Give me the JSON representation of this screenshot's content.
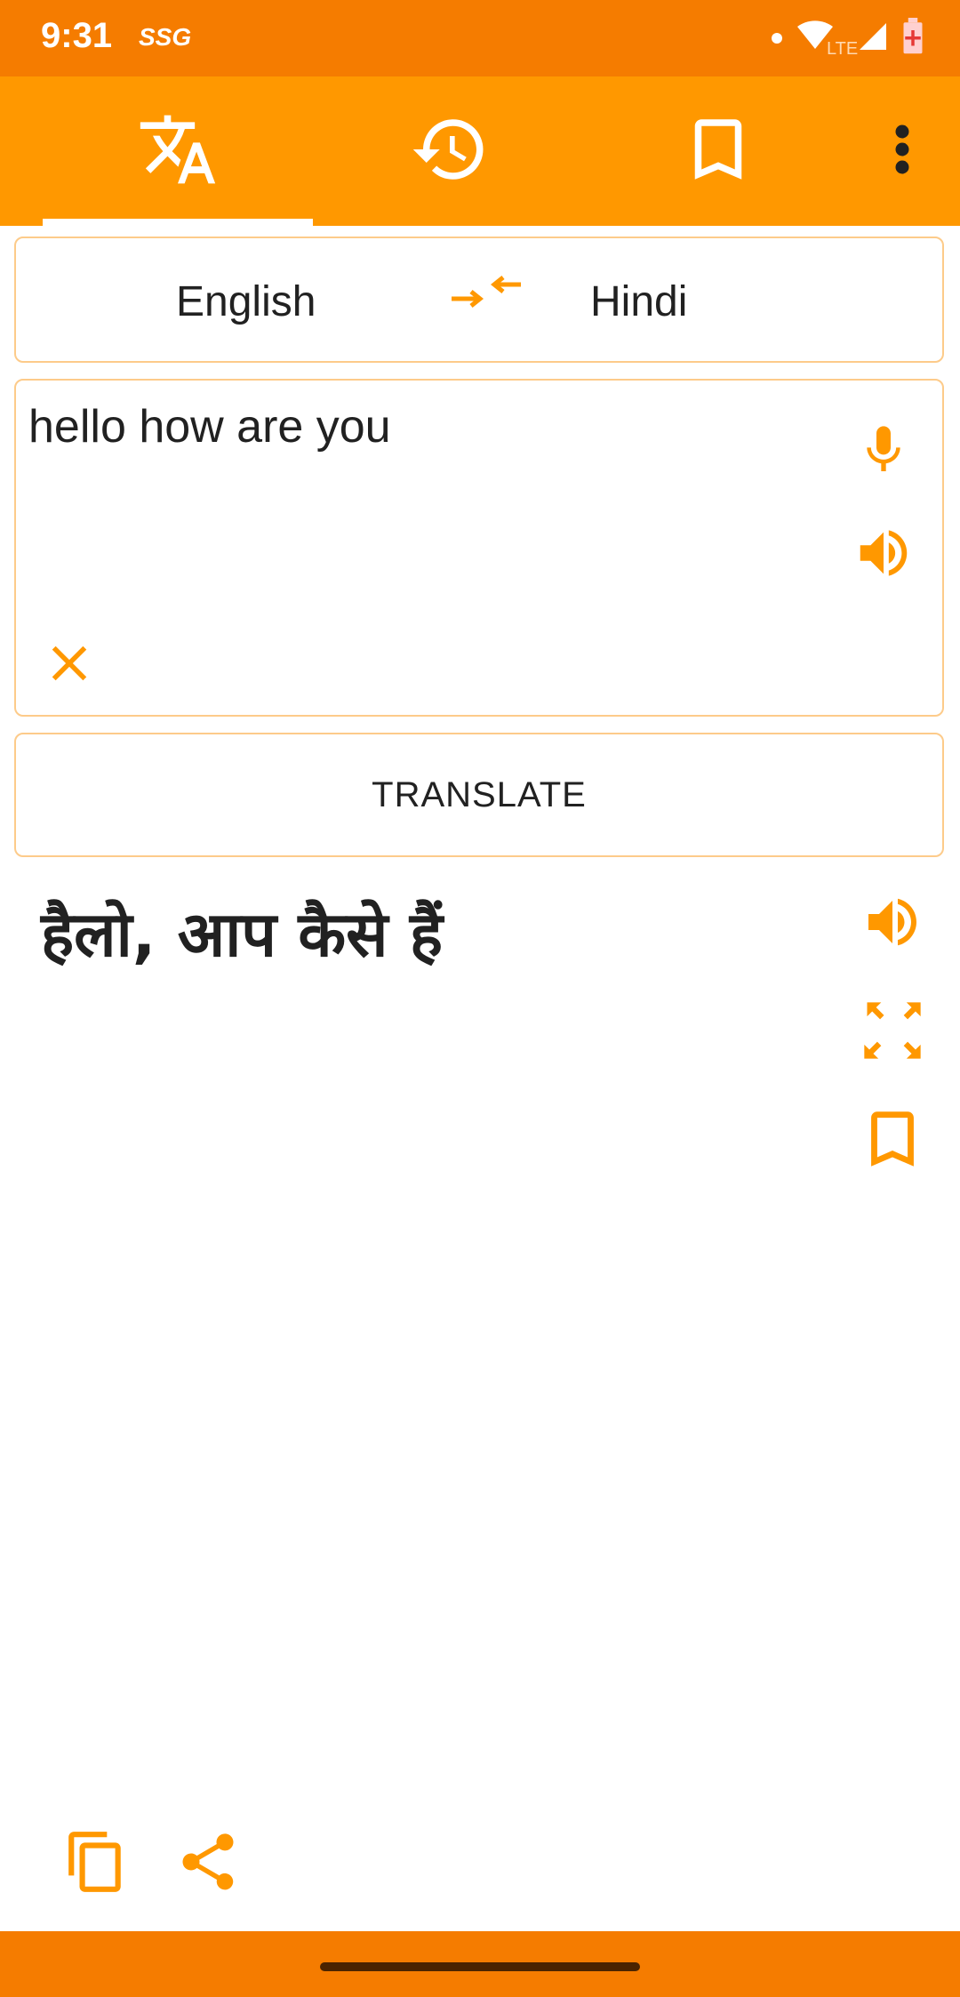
{
  "status_bar": {
    "time": "9:31",
    "carrier": "SSG",
    "network": "LTE"
  },
  "app_bar": {
    "tabs": [
      {
        "name": "translate",
        "icon": "translate-icon",
        "active": true
      },
      {
        "name": "history",
        "icon": "history-icon",
        "active": false
      },
      {
        "name": "bookmarks",
        "icon": "bookmark-icon",
        "active": false
      }
    ],
    "overflow_icon": "more-vert-icon"
  },
  "language_selector": {
    "source": "English",
    "target": "Hindi",
    "swap_icon": "swap-icon"
  },
  "input": {
    "value": "hello how are you",
    "mic_icon": "mic-icon",
    "speaker_icon": "speaker-icon",
    "clear_icon": "close-icon"
  },
  "translate_button": {
    "label": "TRANSLATE"
  },
  "output": {
    "text": "हैलो, आप कैसे हैं"
  },
  "colors": {
    "primary": "#FF9800",
    "primary_dark": "#F57C00",
    "border": "#FDCB8A",
    "text": "#212121"
  }
}
